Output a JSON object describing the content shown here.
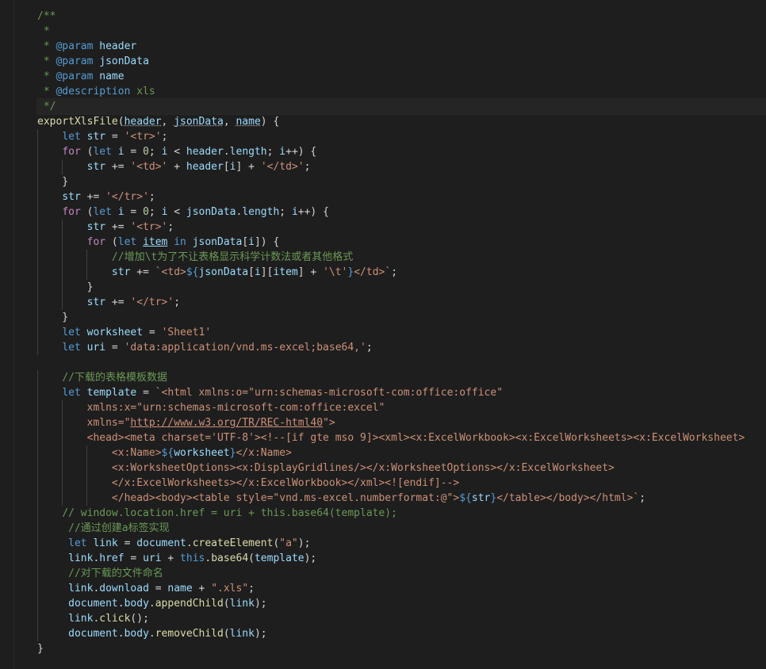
{
  "editor": {
    "language": "javascript",
    "theme": "dark",
    "highlighted_line": 6,
    "lines": [
      [
        {
          "t": "/**",
          "c": "c"
        }
      ],
      [
        {
          "t": " * ",
          "c": "c"
        }
      ],
      [
        {
          "t": " * ",
          "c": "c"
        },
        {
          "t": "@param",
          "c": "k"
        },
        {
          "t": " header",
          "c": "v"
        }
      ],
      [
        {
          "t": " * ",
          "c": "c"
        },
        {
          "t": "@param",
          "c": "k"
        },
        {
          "t": " jsonData",
          "c": "v"
        }
      ],
      [
        {
          "t": " * ",
          "c": "c"
        },
        {
          "t": "@param",
          "c": "k"
        },
        {
          "t": " name",
          "c": "v"
        }
      ],
      [
        {
          "t": " * ",
          "c": "c"
        },
        {
          "t": "@description",
          "c": "k"
        },
        {
          "t": " xls",
          "c": "c"
        }
      ],
      [
        {
          "t": " */",
          "c": "c"
        }
      ],
      [
        {
          "t": "exportXlsFile",
          "c": "f"
        },
        {
          "t": "("
        },
        {
          "t": "header",
          "c": "v uw"
        },
        {
          "t": ", "
        },
        {
          "t": "jsonData",
          "c": "v uw"
        },
        {
          "t": ", "
        },
        {
          "t": "name",
          "c": "v uw"
        },
        {
          "t": ") {"
        }
      ],
      [
        {
          "t": "    "
        },
        {
          "t": "let",
          "c": "k"
        },
        {
          "t": " "
        },
        {
          "t": "str",
          "c": "v"
        },
        {
          "t": " = "
        },
        {
          "t": "'<tr>'",
          "c": "s"
        },
        {
          "t": ";"
        }
      ],
      [
        {
          "t": "    "
        },
        {
          "t": "for",
          "c": "kc"
        },
        {
          "t": " ("
        },
        {
          "t": "let",
          "c": "k"
        },
        {
          "t": " "
        },
        {
          "t": "i",
          "c": "v"
        },
        {
          "t": " = "
        },
        {
          "t": "0",
          "c": "n"
        },
        {
          "t": "; "
        },
        {
          "t": "i",
          "c": "v"
        },
        {
          "t": " < "
        },
        {
          "t": "header",
          "c": "v"
        },
        {
          "t": "."
        },
        {
          "t": "length",
          "c": "v"
        },
        {
          "t": "; "
        },
        {
          "t": "i",
          "c": "v"
        },
        {
          "t": "++) {"
        }
      ],
      [
        {
          "t": "        "
        },
        {
          "t": "str",
          "c": "v"
        },
        {
          "t": " += "
        },
        {
          "t": "'<td>'",
          "c": "s"
        },
        {
          "t": " + "
        },
        {
          "t": "header",
          "c": "v"
        },
        {
          "t": "["
        },
        {
          "t": "i",
          "c": "v"
        },
        {
          "t": "] + "
        },
        {
          "t": "'</td>'",
          "c": "s"
        },
        {
          "t": ";"
        }
      ],
      [
        {
          "t": "    }"
        }
      ],
      [
        {
          "t": "    "
        },
        {
          "t": "str",
          "c": "v"
        },
        {
          "t": " += "
        },
        {
          "t": "'</tr>'",
          "c": "s"
        },
        {
          "t": ";"
        }
      ],
      [
        {
          "t": "    "
        },
        {
          "t": "for",
          "c": "kc"
        },
        {
          "t": " ("
        },
        {
          "t": "let",
          "c": "k"
        },
        {
          "t": " "
        },
        {
          "t": "i",
          "c": "v"
        },
        {
          "t": " = "
        },
        {
          "t": "0",
          "c": "n"
        },
        {
          "t": "; "
        },
        {
          "t": "i",
          "c": "v"
        },
        {
          "t": " < "
        },
        {
          "t": "jsonData",
          "c": "v"
        },
        {
          "t": "."
        },
        {
          "t": "length",
          "c": "v"
        },
        {
          "t": "; "
        },
        {
          "t": "i",
          "c": "v"
        },
        {
          "t": "++) {"
        }
      ],
      [
        {
          "t": "        "
        },
        {
          "t": "str",
          "c": "v"
        },
        {
          "t": " += "
        },
        {
          "t": "'<tr>'",
          "c": "s"
        },
        {
          "t": ";"
        }
      ],
      [
        {
          "t": "        "
        },
        {
          "t": "for",
          "c": "kc"
        },
        {
          "t": " ("
        },
        {
          "t": "let",
          "c": "k"
        },
        {
          "t": " "
        },
        {
          "t": "item",
          "c": "v u"
        },
        {
          "t": " "
        },
        {
          "t": "in",
          "c": "k"
        },
        {
          "t": " "
        },
        {
          "t": "jsonData",
          "c": "v"
        },
        {
          "t": "["
        },
        {
          "t": "i",
          "c": "v"
        },
        {
          "t": "]) {"
        }
      ],
      [
        {
          "t": "            "
        },
        {
          "t": "//增加\\t为了不让表格显示科学计数法或者其他格式",
          "c": "c"
        }
      ],
      [
        {
          "t": "            "
        },
        {
          "t": "str",
          "c": "v"
        },
        {
          "t": " += "
        },
        {
          "t": "`<td>",
          "c": "s"
        },
        {
          "t": "${",
          "c": "k"
        },
        {
          "t": "jsonData",
          "c": "v"
        },
        {
          "t": "["
        },
        {
          "t": "i",
          "c": "v"
        },
        {
          "t": "]["
        },
        {
          "t": "item",
          "c": "v"
        },
        {
          "t": "] + "
        },
        {
          "t": "'\\t'",
          "c": "s"
        },
        {
          "t": "}",
          "c": "k"
        },
        {
          "t": "</td>`",
          "c": "s"
        },
        {
          "t": ";"
        }
      ],
      [
        {
          "t": "        }"
        }
      ],
      [
        {
          "t": "        "
        },
        {
          "t": "str",
          "c": "v"
        },
        {
          "t": " += "
        },
        {
          "t": "'</tr>'",
          "c": "s"
        },
        {
          "t": ";"
        }
      ],
      [
        {
          "t": "    }"
        }
      ],
      [
        {
          "t": "    "
        },
        {
          "t": "let",
          "c": "k"
        },
        {
          "t": " "
        },
        {
          "t": "worksheet",
          "c": "v"
        },
        {
          "t": " = "
        },
        {
          "t": "'Sheet1'",
          "c": "s"
        }
      ],
      [
        {
          "t": "    "
        },
        {
          "t": "let",
          "c": "k"
        },
        {
          "t": " "
        },
        {
          "t": "uri",
          "c": "v"
        },
        {
          "t": " = "
        },
        {
          "t": "'data:application/vnd.ms-excel;base64,'",
          "c": "s"
        },
        {
          "t": ";"
        }
      ],
      [
        {
          "t": ""
        }
      ],
      [
        {
          "t": "    "
        },
        {
          "t": "//下载的表格模板数据",
          "c": "c"
        }
      ],
      [
        {
          "t": "    "
        },
        {
          "t": "let",
          "c": "k"
        },
        {
          "t": " "
        },
        {
          "t": "template",
          "c": "v"
        },
        {
          "t": " = "
        },
        {
          "t": "`<html xmlns:o=\"urn:schemas-microsoft-com:office:office\"",
          "c": "s"
        }
      ],
      [
        {
          "t": "        "
        },
        {
          "t": "xmlns:x=\"urn:schemas-microsoft-com:office:excel\"",
          "c": "s"
        }
      ],
      [
        {
          "t": "        "
        },
        {
          "t": "xmlns=\"",
          "c": "s"
        },
        {
          "t": "http://www.w3.org/TR/REC-html40",
          "c": "s u"
        },
        {
          "t": "\">",
          "c": "s"
        }
      ],
      [
        {
          "t": "        "
        },
        {
          "t": "<head><meta charset='UTF-8'><!--[if gte mso 9]><xml><x:ExcelWorkbook><x:ExcelWorksheets><x:ExcelWorksheet>",
          "c": "s"
        }
      ],
      [
        {
          "t": "            "
        },
        {
          "t": "<x:Name>",
          "c": "s"
        },
        {
          "t": "${",
          "c": "k"
        },
        {
          "t": "worksheet",
          "c": "v"
        },
        {
          "t": "}",
          "c": "k"
        },
        {
          "t": "</x:Name>",
          "c": "s"
        }
      ],
      [
        {
          "t": "            "
        },
        {
          "t": "<x:WorksheetOptions><x:DisplayGridlines/></x:WorksheetOptions></x:ExcelWorksheet>",
          "c": "s"
        }
      ],
      [
        {
          "t": "            "
        },
        {
          "t": "</x:ExcelWorksheets></x:ExcelWorkbook></xml><![endif]-->",
          "c": "s"
        }
      ],
      [
        {
          "t": "            "
        },
        {
          "t": "</head><body><table style=\"vnd.ms-excel.numberformat:@\">",
          "c": "s"
        },
        {
          "t": "${",
          "c": "k"
        },
        {
          "t": "str",
          "c": "v"
        },
        {
          "t": "}",
          "c": "k"
        },
        {
          "t": "</table></body></html>`",
          "c": "s"
        },
        {
          "t": ";"
        }
      ],
      [
        {
          "t": "    "
        },
        {
          "t": "// window.location.href = uri + this.base64(template);",
          "c": "c"
        }
      ],
      [
        {
          "t": "     "
        },
        {
          "t": "//通过创建a标签实现",
          "c": "c"
        }
      ],
      [
        {
          "t": "     "
        },
        {
          "t": "let",
          "c": "k"
        },
        {
          "t": " "
        },
        {
          "t": "link",
          "c": "v"
        },
        {
          "t": " = "
        },
        {
          "t": "document",
          "c": "v"
        },
        {
          "t": "."
        },
        {
          "t": "createElement",
          "c": "f"
        },
        {
          "t": "("
        },
        {
          "t": "\"a\"",
          "c": "s"
        },
        {
          "t": ");"
        }
      ],
      [
        {
          "t": "     "
        },
        {
          "t": "link",
          "c": "v"
        },
        {
          "t": "."
        },
        {
          "t": "href",
          "c": "v"
        },
        {
          "t": " = "
        },
        {
          "t": "uri",
          "c": "v"
        },
        {
          "t": " + "
        },
        {
          "t": "this",
          "c": "k"
        },
        {
          "t": "."
        },
        {
          "t": "base64",
          "c": "f"
        },
        {
          "t": "("
        },
        {
          "t": "template",
          "c": "v"
        },
        {
          "t": ");"
        }
      ],
      [
        {
          "t": "     "
        },
        {
          "t": "//对下载的文件命名",
          "c": "c"
        }
      ],
      [
        {
          "t": "     "
        },
        {
          "t": "link",
          "c": "v"
        },
        {
          "t": "."
        },
        {
          "t": "download",
          "c": "v"
        },
        {
          "t": " = "
        },
        {
          "t": "name",
          "c": "v"
        },
        {
          "t": " + "
        },
        {
          "t": "\".xls\"",
          "c": "s"
        },
        {
          "t": ";"
        }
      ],
      [
        {
          "t": "     "
        },
        {
          "t": "document",
          "c": "v"
        },
        {
          "t": "."
        },
        {
          "t": "body",
          "c": "v"
        },
        {
          "t": "."
        },
        {
          "t": "appendChild",
          "c": "f"
        },
        {
          "t": "("
        },
        {
          "t": "link",
          "c": "v"
        },
        {
          "t": ");"
        }
      ],
      [
        {
          "t": "     "
        },
        {
          "t": "link",
          "c": "v"
        },
        {
          "t": "."
        },
        {
          "t": "click",
          "c": "f"
        },
        {
          "t": "();"
        }
      ],
      [
        {
          "t": "     "
        },
        {
          "t": "document",
          "c": "v"
        },
        {
          "t": "."
        },
        {
          "t": "body",
          "c": "v"
        },
        {
          "t": "."
        },
        {
          "t": "removeChild",
          "c": "f"
        },
        {
          "t": "("
        },
        {
          "t": "link",
          "c": "v"
        },
        {
          "t": ");"
        }
      ],
      [
        {
          "t": "}"
        }
      ]
    ]
  }
}
